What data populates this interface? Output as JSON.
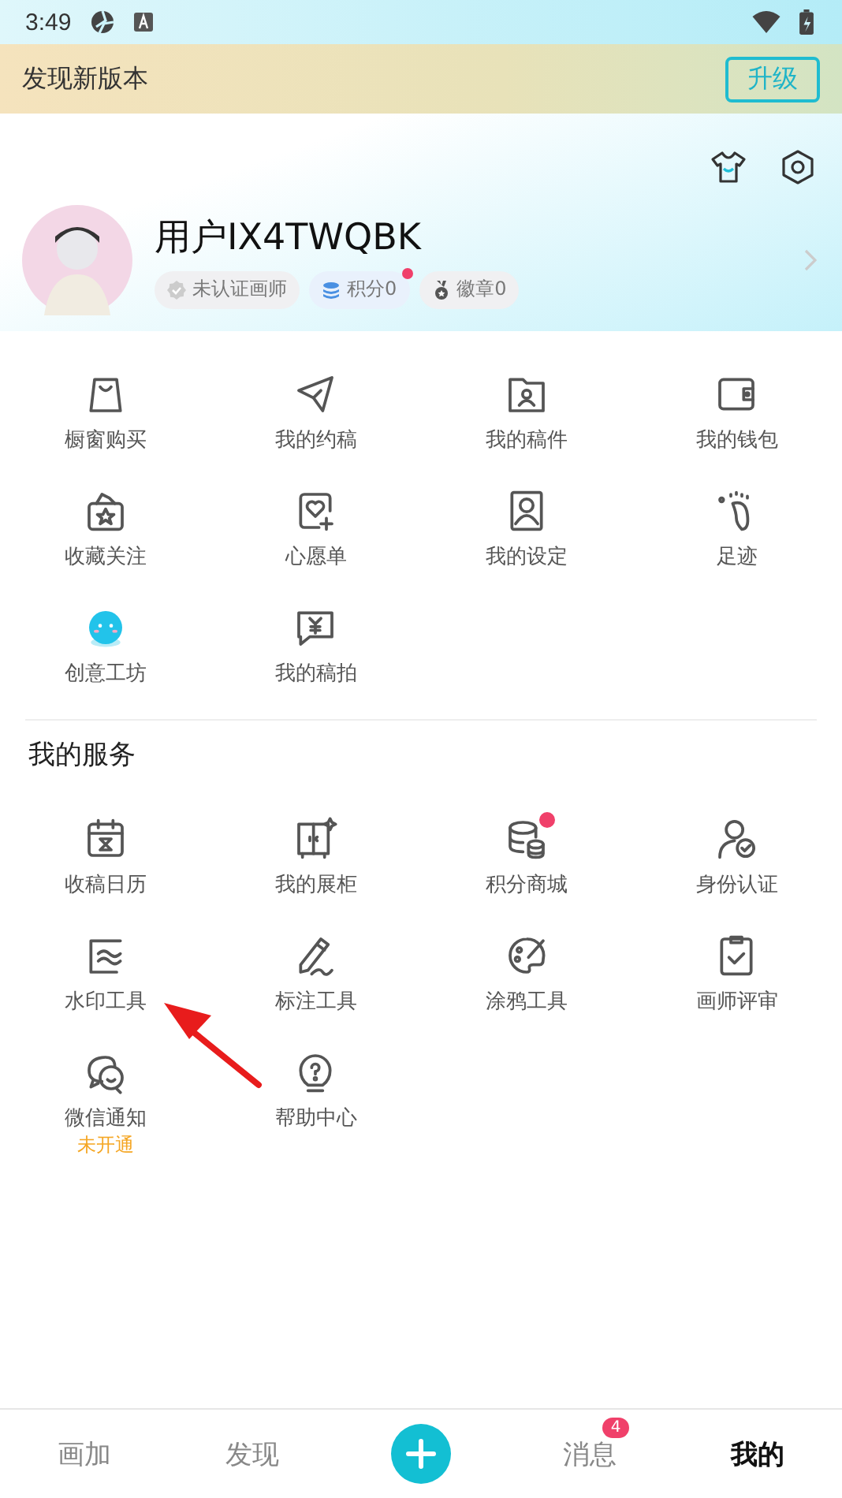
{
  "status_bar": {
    "time": "3:49"
  },
  "update_banner": {
    "text": "发现新版本",
    "button": "升级"
  },
  "profile": {
    "name": "用户IX4TWQBK",
    "badges": [
      {
        "label": "未认证画师",
        "dot": false
      },
      {
        "label": "积分0",
        "dot": true
      },
      {
        "label": "徽章0",
        "dot": false
      }
    ]
  },
  "shortcuts": [
    {
      "label": "橱窗购买",
      "dot": false
    },
    {
      "label": "我的约稿",
      "dot": false
    },
    {
      "label": "我的稿件",
      "dot": false
    },
    {
      "label": "我的钱包",
      "dot": false
    },
    {
      "label": "收藏关注",
      "dot": false
    },
    {
      "label": "心愿单",
      "dot": false
    },
    {
      "label": "我的设定",
      "dot": false
    },
    {
      "label": "足迹",
      "dot": false
    },
    {
      "label": "创意工坊",
      "dot": false
    },
    {
      "label": "我的稿拍",
      "dot": false
    }
  ],
  "services": {
    "title": "我的服务",
    "items": [
      {
        "label": "收稿日历",
        "dot": false
      },
      {
        "label": "我的展柜",
        "dot": false
      },
      {
        "label": "积分商城",
        "dot": true
      },
      {
        "label": "身份认证",
        "dot": false
      },
      {
        "label": "水印工具",
        "dot": false
      },
      {
        "label": "标注工具",
        "dot": false
      },
      {
        "label": "涂鸦工具",
        "dot": false
      },
      {
        "label": "画师评审",
        "dot": false
      },
      {
        "label": "微信通知",
        "dot": false,
        "status": "未开通"
      },
      {
        "label": "帮助中心",
        "dot": false
      }
    ]
  },
  "bottom_nav": [
    {
      "label": "画加",
      "kind": "tab",
      "selected": false
    },
    {
      "label": "发现",
      "kind": "tab",
      "selected": false
    },
    {
      "kind": "add"
    },
    {
      "label": "消息",
      "kind": "tab",
      "selected": false,
      "badge": "4"
    },
    {
      "label": "我的",
      "kind": "tab",
      "selected": true
    }
  ]
}
